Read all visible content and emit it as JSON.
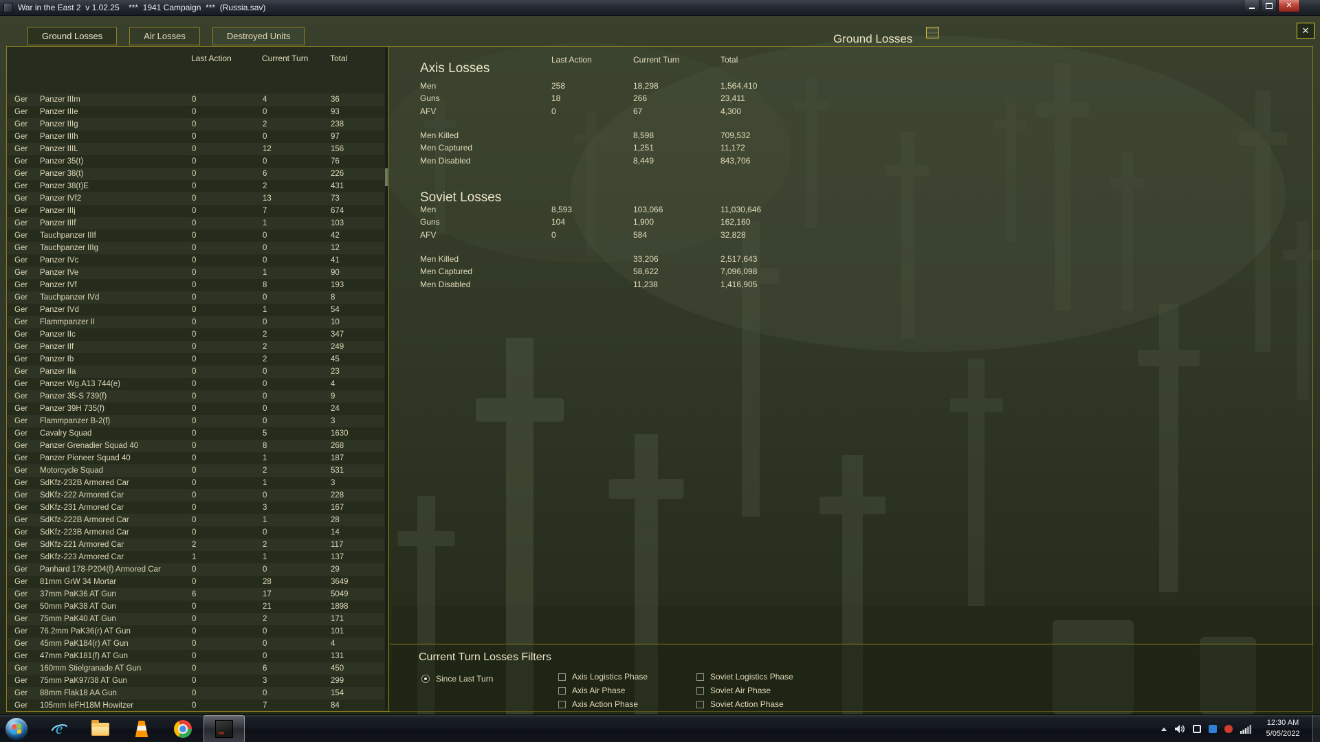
{
  "colors": {
    "gold": "#8f7e22",
    "gold-bright": "#ddc830",
    "text": "#e3dcba",
    "title-text": "#ece5c6"
  },
  "icons": {
    "close_glyph": "✕",
    "names": [
      "app-icon",
      "minimize-icon",
      "maximize-icon",
      "close-icon",
      "help-icon",
      "start-orb-icon",
      "internet-explorer-icon",
      "windows-explorer-icon",
      "vlc-icon",
      "chrome-icon",
      "wite2-icon",
      "hidden-icons-chevron",
      "volume-icon",
      "tray-white-icon",
      "tray-blue-icon",
      "tray-red-icon",
      "network-icon"
    ]
  },
  "window": {
    "title": "War in the East 2  v 1.02.25    ***  1941 Campaign  ***  (Russia.sav)",
    "screen_title": "Ground Losses"
  },
  "tabs": [
    {
      "label": "Ground Losses",
      "active": true
    },
    {
      "label": "Air Losses",
      "active": false
    },
    {
      "label": "Destroyed Units",
      "active": false
    }
  ],
  "left_table": {
    "headers": [
      "Last Action",
      "Current Turn",
      "Total"
    ],
    "rows": [
      [
        "Ger",
        "Panzer IIIm",
        "0",
        "4",
        "36"
      ],
      [
        "Ger",
        "Panzer IIIe",
        "0",
        "0",
        "93"
      ],
      [
        "Ger",
        "Panzer IIIg",
        "0",
        "2",
        "238"
      ],
      [
        "Ger",
        "Panzer IIIh",
        "0",
        "0",
        "97"
      ],
      [
        "Ger",
        "Panzer IIIL",
        "0",
        "12",
        "156"
      ],
      [
        "Ger",
        "Panzer 35(t)",
        "0",
        "0",
        "76"
      ],
      [
        "Ger",
        "Panzer 38(t)",
        "0",
        "6",
        "226"
      ],
      [
        "Ger",
        "Panzer 38(t)E",
        "0",
        "2",
        "431"
      ],
      [
        "Ger",
        "Panzer IVf2",
        "0",
        "13",
        "73"
      ],
      [
        "Ger",
        "Panzer IIIj",
        "0",
        "7",
        "674"
      ],
      [
        "Ger",
        "Panzer IIIf",
        "0",
        "1",
        "103"
      ],
      [
        "Ger",
        "Tauchpanzer IIIf",
        "0",
        "0",
        "42"
      ],
      [
        "Ger",
        "Tauchpanzer IIIg",
        "0",
        "0",
        "12"
      ],
      [
        "Ger",
        "Panzer IVc",
        "0",
        "0",
        "41"
      ],
      [
        "Ger",
        "Panzer IVe",
        "0",
        "1",
        "90"
      ],
      [
        "Ger",
        "Panzer IVf",
        "0",
        "8",
        "193"
      ],
      [
        "Ger",
        "Tauchpanzer IVd",
        "0",
        "0",
        "8"
      ],
      [
        "Ger",
        "Panzer IVd",
        "0",
        "1",
        "54"
      ],
      [
        "Ger",
        "Flammpanzer II",
        "0",
        "0",
        "10"
      ],
      [
        "Ger",
        "Panzer IIc",
        "0",
        "2",
        "347"
      ],
      [
        "Ger",
        "Panzer IIf",
        "0",
        "2",
        "249"
      ],
      [
        "Ger",
        "Panzer Ib",
        "0",
        "2",
        "45"
      ],
      [
        "Ger",
        "Panzer IIa",
        "0",
        "0",
        "23"
      ],
      [
        "Ger",
        "Panzer Wg.A13 744(e)",
        "0",
        "0",
        "4"
      ],
      [
        "Ger",
        "Panzer 35-S 739(f)",
        "0",
        "0",
        "9"
      ],
      [
        "Ger",
        "Panzer 39H 735(f)",
        "0",
        "0",
        "24"
      ],
      [
        "Ger",
        "Flammpanzer B-2(f)",
        "0",
        "0",
        "3"
      ],
      [
        "Ger",
        "Cavalry Squad",
        "0",
        "5",
        "1630"
      ],
      [
        "Ger",
        "Panzer Grenadier Squad 40",
        "0",
        "8",
        "268"
      ],
      [
        "Ger",
        "Panzer Pioneer Squad 40",
        "0",
        "1",
        "187"
      ],
      [
        "Ger",
        "Motorcycle Squad",
        "0",
        "2",
        "531"
      ],
      [
        "Ger",
        "SdKfz-232B Armored Car",
        "0",
        "1",
        "3"
      ],
      [
        "Ger",
        "SdKfz-222 Armored Car",
        "0",
        "0",
        "228"
      ],
      [
        "Ger",
        "SdKfz-231 Armored Car",
        "0",
        "3",
        "167"
      ],
      [
        "Ger",
        "SdKfz-222B Armored Car",
        "0",
        "1",
        "28"
      ],
      [
        "Ger",
        "SdKfz-223B Armored Car",
        "0",
        "0",
        "14"
      ],
      [
        "Ger",
        "SdKfz-221 Armored Car",
        "2",
        "2",
        "117"
      ],
      [
        "Ger",
        "SdKfz-223 Armored Car",
        "1",
        "1",
        "137"
      ],
      [
        "Ger",
        "Panhard 178-P204(f) Armored Car",
        "0",
        "0",
        "29"
      ],
      [
        "Ger",
        "81mm GrW 34 Mortar",
        "0",
        "28",
        "3649"
      ],
      [
        "Ger",
        "37mm PaK36 AT Gun",
        "6",
        "17",
        "5049"
      ],
      [
        "Ger",
        "50mm PaK38 AT Gun",
        "0",
        "21",
        "1898"
      ],
      [
        "Ger",
        "75mm PaK40 AT Gun",
        "0",
        "2",
        "171"
      ],
      [
        "Ger",
        "76.2mm PaK36(r) AT Gun",
        "0",
        "0",
        "101"
      ],
      [
        "Ger",
        "45mm PaK184(r) AT Gun",
        "0",
        "0",
        "4"
      ],
      [
        "Ger",
        "47mm PaK181(f) AT Gun",
        "0",
        "0",
        "131"
      ],
      [
        "Ger",
        "160mm Stielgranade AT Gun",
        "0",
        "6",
        "450"
      ],
      [
        "Ger",
        "75mm PaK97/38 AT Gun",
        "0",
        "3",
        "299"
      ],
      [
        "Ger",
        "88mm Flak18 AA Gun",
        "0",
        "0",
        "154"
      ],
      [
        "Ger",
        "105mm leFH18M Howitzer",
        "0",
        "7",
        "84"
      ]
    ]
  },
  "summary": {
    "headers": [
      "Last Action",
      "Current Turn",
      "Total"
    ],
    "sections": [
      {
        "title": "Axis Losses",
        "main": [
          [
            "Men",
            "258",
            "18,298",
            "1,564,410"
          ],
          [
            "Guns",
            "18",
            "266",
            "23,411"
          ],
          [
            "AFV",
            "0",
            "67",
            "4,300"
          ]
        ],
        "breakdown": [
          [
            "Men Killed",
            "",
            "8,598",
            "709,532"
          ],
          [
            "Men Captured",
            "",
            "1,251",
            "11,172"
          ],
          [
            "Men Disabled",
            "",
            "8,449",
            "843,706"
          ]
        ]
      },
      {
        "title": "Soviet Losses",
        "main": [
          [
            "Men",
            "8,593",
            "103,066",
            "11,030,646"
          ],
          [
            "Guns",
            "104",
            "1,900",
            "162,160"
          ],
          [
            "AFV",
            "0",
            "584",
            "32,828"
          ]
        ],
        "breakdown": [
          [
            "Men Killed",
            "",
            "33,206",
            "2,517,643"
          ],
          [
            "Men Captured",
            "",
            "58,622",
            "7,096,098"
          ],
          [
            "Men Disabled",
            "",
            "11,238",
            "1,416,905"
          ]
        ]
      }
    ]
  },
  "filters": {
    "title": "Current Turn Losses Filters",
    "since_last_turn": {
      "label": "Since Last Turn",
      "selected": true
    },
    "columns": [
      [
        "Axis Logistics Phase",
        "Axis Air Phase",
        "Axis Action Phase"
      ],
      [
        "Soviet Logistics Phase",
        "Soviet Air Phase",
        "Soviet Action Phase"
      ]
    ]
  },
  "taskbar": {
    "clock_time": "12:30 AM",
    "clock_date": "5/05/2022"
  }
}
